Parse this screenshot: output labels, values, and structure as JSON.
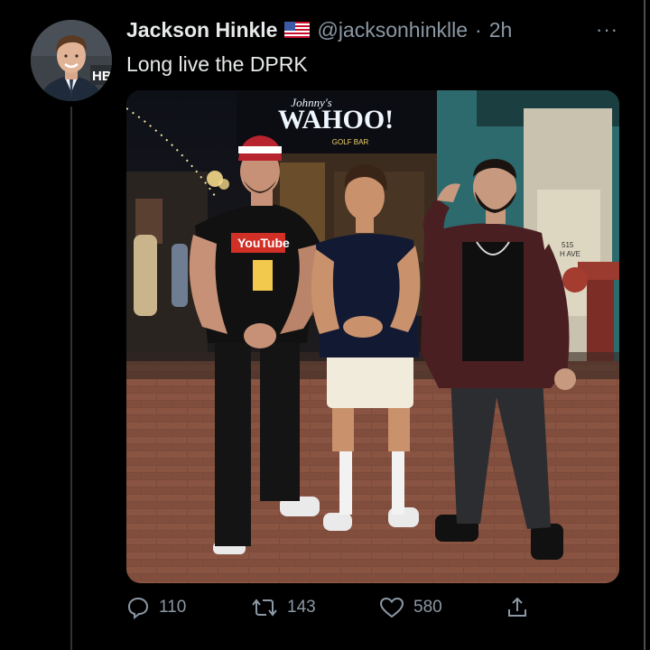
{
  "tweet": {
    "author_name": "Jackson Hinkle",
    "handle": "@jacksonhinklle",
    "separator": "·",
    "time": "2h",
    "text": "Long live the DPRK",
    "more_label": "···",
    "avatar_logo_text": "HB"
  },
  "media": {
    "sign_text": "WAHOO!",
    "sign_script": "Johnny's",
    "sign_sub": "GOLF BAR",
    "shirt_text": "YouTube",
    "wall_text_1": "515",
    "wall_text_2": "H AVE"
  },
  "actions": {
    "reply_count": "110",
    "retweet_count": "143",
    "like_count": "580"
  },
  "colors": {
    "background": "#000000",
    "text_primary": "#e7e9ea",
    "text_secondary": "#8b98a5",
    "divider": "#2f3336"
  }
}
